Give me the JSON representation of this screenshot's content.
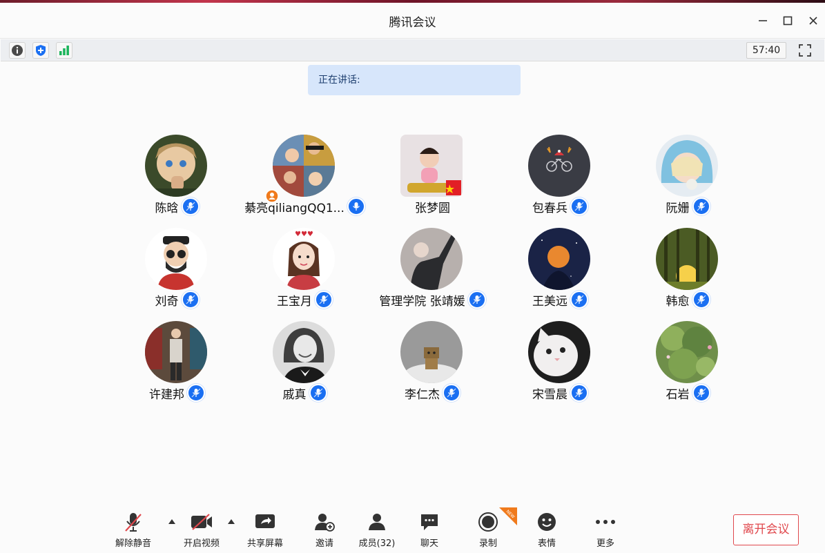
{
  "window": {
    "title": "腾讯会议"
  },
  "toolbar": {
    "timer": "57:40"
  },
  "speaking": {
    "label": "正在讲话:"
  },
  "participants": [
    {
      "name": "陈晗",
      "mic": true,
      "avatar": "anime-boy"
    },
    {
      "name": "綦亮qiliangQQ1...",
      "mic": true,
      "avatar": "family-collage",
      "host": true
    },
    {
      "name": "张梦圆",
      "mic": false,
      "avatar": "toddler"
    },
    {
      "name": "包春兵",
      "mic": true,
      "avatar": "deer-bike"
    },
    {
      "name": "阮姗",
      "mic": true,
      "avatar": "girl-blue-hood"
    },
    {
      "name": "刘奇",
      "mic": true,
      "avatar": "cartoon-sunglasses"
    },
    {
      "name": "王宝月",
      "mic": true,
      "avatar": "cartoon-girl"
    },
    {
      "name": "管理学院 张靖媛",
      "mic": true,
      "avatar": "man-pointing"
    },
    {
      "name": "王美远",
      "mic": true,
      "avatar": "moon-night"
    },
    {
      "name": "韩愈",
      "mic": true,
      "avatar": "forest-sunset"
    },
    {
      "name": "许建邦",
      "mic": true,
      "avatar": "street-person"
    },
    {
      "name": "戚真",
      "mic": true,
      "avatar": "smiling-woman"
    },
    {
      "name": "李仁杰",
      "mic": true,
      "avatar": "box-robot"
    },
    {
      "name": "宋雪晨",
      "mic": true,
      "avatar": "white-cat"
    },
    {
      "name": "石岩",
      "mic": true,
      "avatar": "green-tree"
    }
  ],
  "bottom": {
    "unmute": "解除静音",
    "video": "开启视频",
    "share": "共享屏幕",
    "invite": "邀请",
    "members": "成员(32)",
    "chat": "聊天",
    "record": "录制",
    "record_badge": "NEW",
    "emoji": "表情",
    "more": "更多",
    "leave": "离开会议"
  },
  "colors": {
    "accent_blue": "#1a6ff2",
    "leave_red": "#e0474c",
    "speaking_bg": "#d7e6fb"
  }
}
